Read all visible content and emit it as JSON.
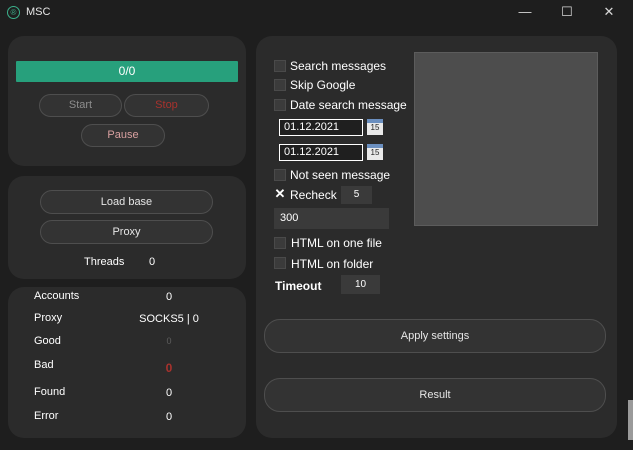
{
  "window": {
    "title": "MSC",
    "app_icon_glyph": "®",
    "minimize_glyph": "—",
    "maximize_glyph": "☐",
    "close_glyph": "✕"
  },
  "controls": {
    "progress_text": "0/0",
    "start_label": "Start",
    "stop_label": "Stop",
    "pause_label": "Pause"
  },
  "base": {
    "load_base_label": "Load base",
    "proxy_label": "Proxy",
    "threads_label": "Threads",
    "threads_value": "0"
  },
  "stats": {
    "accounts_label": "Accounts",
    "accounts_value": "0",
    "proxy_label": "Proxy",
    "proxy_value": "SOCKS5 | 0",
    "good_label": "Good",
    "good_value": "0",
    "bad_label": "Bad",
    "bad_value": "0",
    "found_label": "Found",
    "found_value": "0",
    "error_label": "Error",
    "error_value": "0"
  },
  "settings": {
    "search_messages_label": "Search messages",
    "skip_google_label": "Skip Google",
    "date_search_label": "Date search message",
    "date_from": "01.12.2021",
    "date_to": "01.12.2021",
    "calendar_day": "15",
    "not_seen_label": "Not seen message",
    "recheck_label": "Recheck",
    "recheck_value": "5",
    "recheck_check_glyph": "✕",
    "text_value": "300",
    "html_one_file_label": "HTML on one file",
    "html_folder_label": "HTML on folder",
    "timeout_label": "Timeout",
    "timeout_value": "10",
    "apply_label": "Apply settings",
    "result_label": "Result"
  },
  "colors": {
    "progress": "#27a07c",
    "stop_text": "#a8322d",
    "bad_dot": "#a8322d",
    "good_dim": "#6b6b6b"
  }
}
